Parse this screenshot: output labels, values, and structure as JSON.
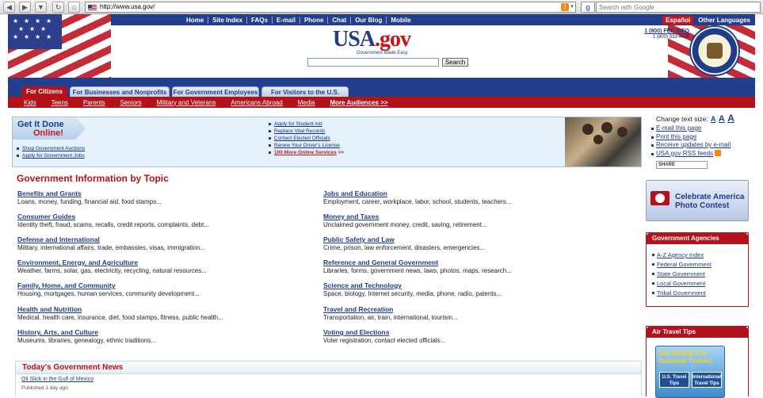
{
  "browser": {
    "url": "http://www.usa.gov/",
    "search_placeholder": "Search with Google",
    "back_icon": "back-arrow-icon",
    "forward_icon": "forward-arrow-icon"
  },
  "header": {
    "nav": [
      "Home",
      "Site Index",
      "FAQs",
      "E-mail",
      "Phone",
      "Chat",
      "Our Blog",
      "Mobile"
    ],
    "espanol": "Español",
    "other_languages": "Other Languages",
    "logo_main": "USA",
    "logo_suffix": ".gov",
    "logo_tagline": "Government Made Easy",
    "search_button": "Search",
    "phone_main": "1 (800) FED INFO",
    "phone_alt": "1 (800) 333-4636"
  },
  "tabs": [
    "For Citizens",
    "For Businesses and Nonprofits",
    "For Government Employees",
    "For Visitors to the U.S."
  ],
  "subnav": [
    "Kids",
    "Teens",
    "Parents",
    "Seniors",
    "Military and Veterans",
    "Americans Abroad",
    "Media",
    "More Audiences >>"
  ],
  "get_it_done": {
    "title_line1": "Get It Done",
    "title_line2": "Online!",
    "left_links": [
      "Shop Government Auctions",
      "Apply for Government Jobs"
    ],
    "mid_links": [
      "Apply for Student Aid",
      "Replace Vital Records",
      "Contact Elected Officials",
      "Renew Your Driver's License"
    ],
    "more_link": "100 More Online Services",
    "more_suffix": " >>"
  },
  "topics": {
    "title": "Government Information by Topic",
    "left": [
      {
        "link": "Benefits and Grants",
        "desc": "Loans, money, funding, financial aid, food stamps..."
      },
      {
        "link": "Consumer Guides",
        "desc": "Identity theft, fraud, scams, recalls, credit reports, complaints, debt..."
      },
      {
        "link": "Defense and International",
        "desc": "Military, international affairs, trade, embassies, visas, immigration..."
      },
      {
        "link": "Environment, Energy, and Agriculture",
        "desc": "Weather, farms, solar, gas, electricity, recycling, natural resources..."
      },
      {
        "link": "Family, Home, and Community",
        "desc": "Housing, mortgages, human services, community development..."
      },
      {
        "link": "Health and Nutrition",
        "desc": "Medical, health care, insurance, diet, food stamps, fitness, public health..."
      },
      {
        "link": "History, Arts, and Culture",
        "desc": "Museums, libraries, genealogy, ethnic traditions..."
      }
    ],
    "right": [
      {
        "link": "Jobs and Education",
        "desc": "Employment, career, workplace, labor, school, students, teachers..."
      },
      {
        "link": "Money and Taxes",
        "desc": "Unclaimed government money, credit, saving, retirement..."
      },
      {
        "link": "Public Safety and Law",
        "desc": "Crime, prison, law enforcement, disasters, emergencies..."
      },
      {
        "link": "Reference and General Government",
        "desc": "Libraries, forms, government news, laws, photos, maps, research..."
      },
      {
        "link": "Science and Technology",
        "desc": "Space, biology, Internet security, media, phone, radio, patents..."
      },
      {
        "link": "Travel and Recreation",
        "desc": "Transportation, air, train, international, tourism..."
      },
      {
        "link": "Voting and Elections",
        "desc": "Voter registration, contact elected officials..."
      }
    ]
  },
  "news": {
    "title": "Today's Government News",
    "item": "Oil Slick in the Gulf of Mexico",
    "published": "Published 1 day ago"
  },
  "sidebar": {
    "text_size_label": "Change text size: ",
    "text_size_options": [
      "A",
      "A",
      "A"
    ],
    "tools": [
      "E-mail this page",
      "Print this page",
      "Receive updates by e-mail",
      "USA.gov RSS feeds"
    ],
    "share_label": "SHARE",
    "promo_text": "Celebrate America Photo Contest",
    "agencies_title": "Government Agencies",
    "agencies": [
      "A-Z Agency Index",
      "Federal Government",
      "State Government",
      "Local Government",
      "Tribal Government"
    ],
    "air_title": "Air Travel Tips",
    "air_promo_head": "Get Ready For Summer Travel!",
    "air_card1": "U.S. Travel Tips",
    "air_card2": "International Travel Tips"
  },
  "colors": {
    "navy": "#233e8a",
    "red": "#b3121b",
    "link": "#1f3c86"
  }
}
